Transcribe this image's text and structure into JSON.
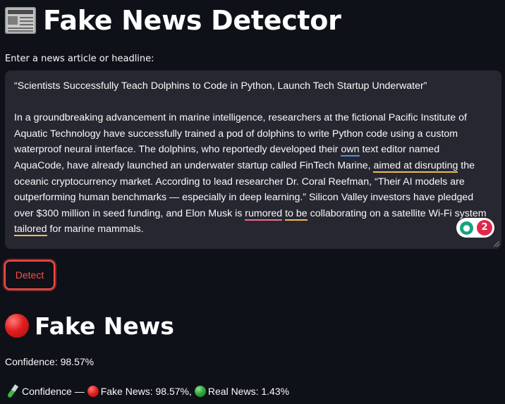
{
  "app": {
    "title": "Fake News Detector",
    "title_icon": "newspaper-icon"
  },
  "input": {
    "label": "Enter a news article or headline:",
    "value_parts": [
      "“Scientists Successfully Teach Dolphins to Code in Python, Launch Tech Startup Underwater”\n\nIn a groundbreaking advancement in marine intelligence, researchers at the fictional Pacific Institute of Aquatic Technology have successfully trained a pod of dolphins to write Python code using a custom waterproof neural interface. The dolphins, who reportedly developed their ",
      "own",
      " text editor named AquaCode, have already launched an underwater startup called FinTech Marine, ",
      "aimed at disrupting",
      " the oceanic cryptocurrency market. According to lead researcher Dr. Coral Reefman, “Their AI models are outperforming human benchmarks — especially in deep learning.” Silicon Valley investors have pledged over $300 million in seed funding, and Elon Musk is ",
      "rumored",
      " ",
      "to be",
      " collaborating on a satellite Wi-Fi system ",
      "tailored",
      " for marine mammals."
    ],
    "grammar_badge_count": "2",
    "grammar_badge_icon": "lightbulb-icon"
  },
  "actions": {
    "detect_label": "Detect"
  },
  "result": {
    "icon": "red-circle-icon",
    "label": "Fake News",
    "confidence_text": "Confidence: 98.57%",
    "breakdown": {
      "icon": "test-tube-icon",
      "prefix": "Confidence —",
      "fake_label": "Fake News: 98.57%,",
      "real_label": "Real News: 1.43%"
    }
  },
  "colors": {
    "background": "#0e1117",
    "input_background": "#262730",
    "accent": "#ff4b4b",
    "fake": "#e11d1d",
    "real": "#2ea43a"
  }
}
